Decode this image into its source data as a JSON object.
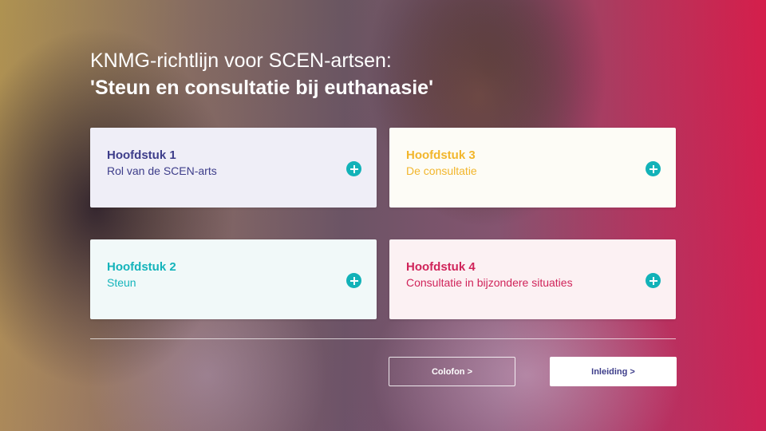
{
  "header": {
    "title_line1": "KNMG-richtlijn voor SCEN-artsen:",
    "title_line2": "'Steun en consultatie bij euthanasie'"
  },
  "chapters": [
    {
      "heading": "Hoofdstuk 1",
      "subtitle": "Rol van de SCEN-arts",
      "color": "#3d3d8a",
      "icon": "plus-circle-icon"
    },
    {
      "heading": "Hoofdstuk 2",
      "subtitle": "Steun",
      "color": "#14b4bb",
      "icon": "plus-circle-icon"
    },
    {
      "heading": "Hoofdstuk 3",
      "subtitle": "De consultatie",
      "color": "#f2b62c",
      "icon": "plus-circle-icon"
    },
    {
      "heading": "Hoofdstuk 4",
      "subtitle": "Consultatie in bijzondere situaties",
      "color": "#d0245a",
      "icon": "plus-circle-icon"
    }
  ],
  "footer": {
    "colofon_label": "Colofon >",
    "inleiding_label": "Inleiding >"
  },
  "colors": {
    "accent_teal": "#12b2b8",
    "brand_purple": "#3d3d8a"
  }
}
